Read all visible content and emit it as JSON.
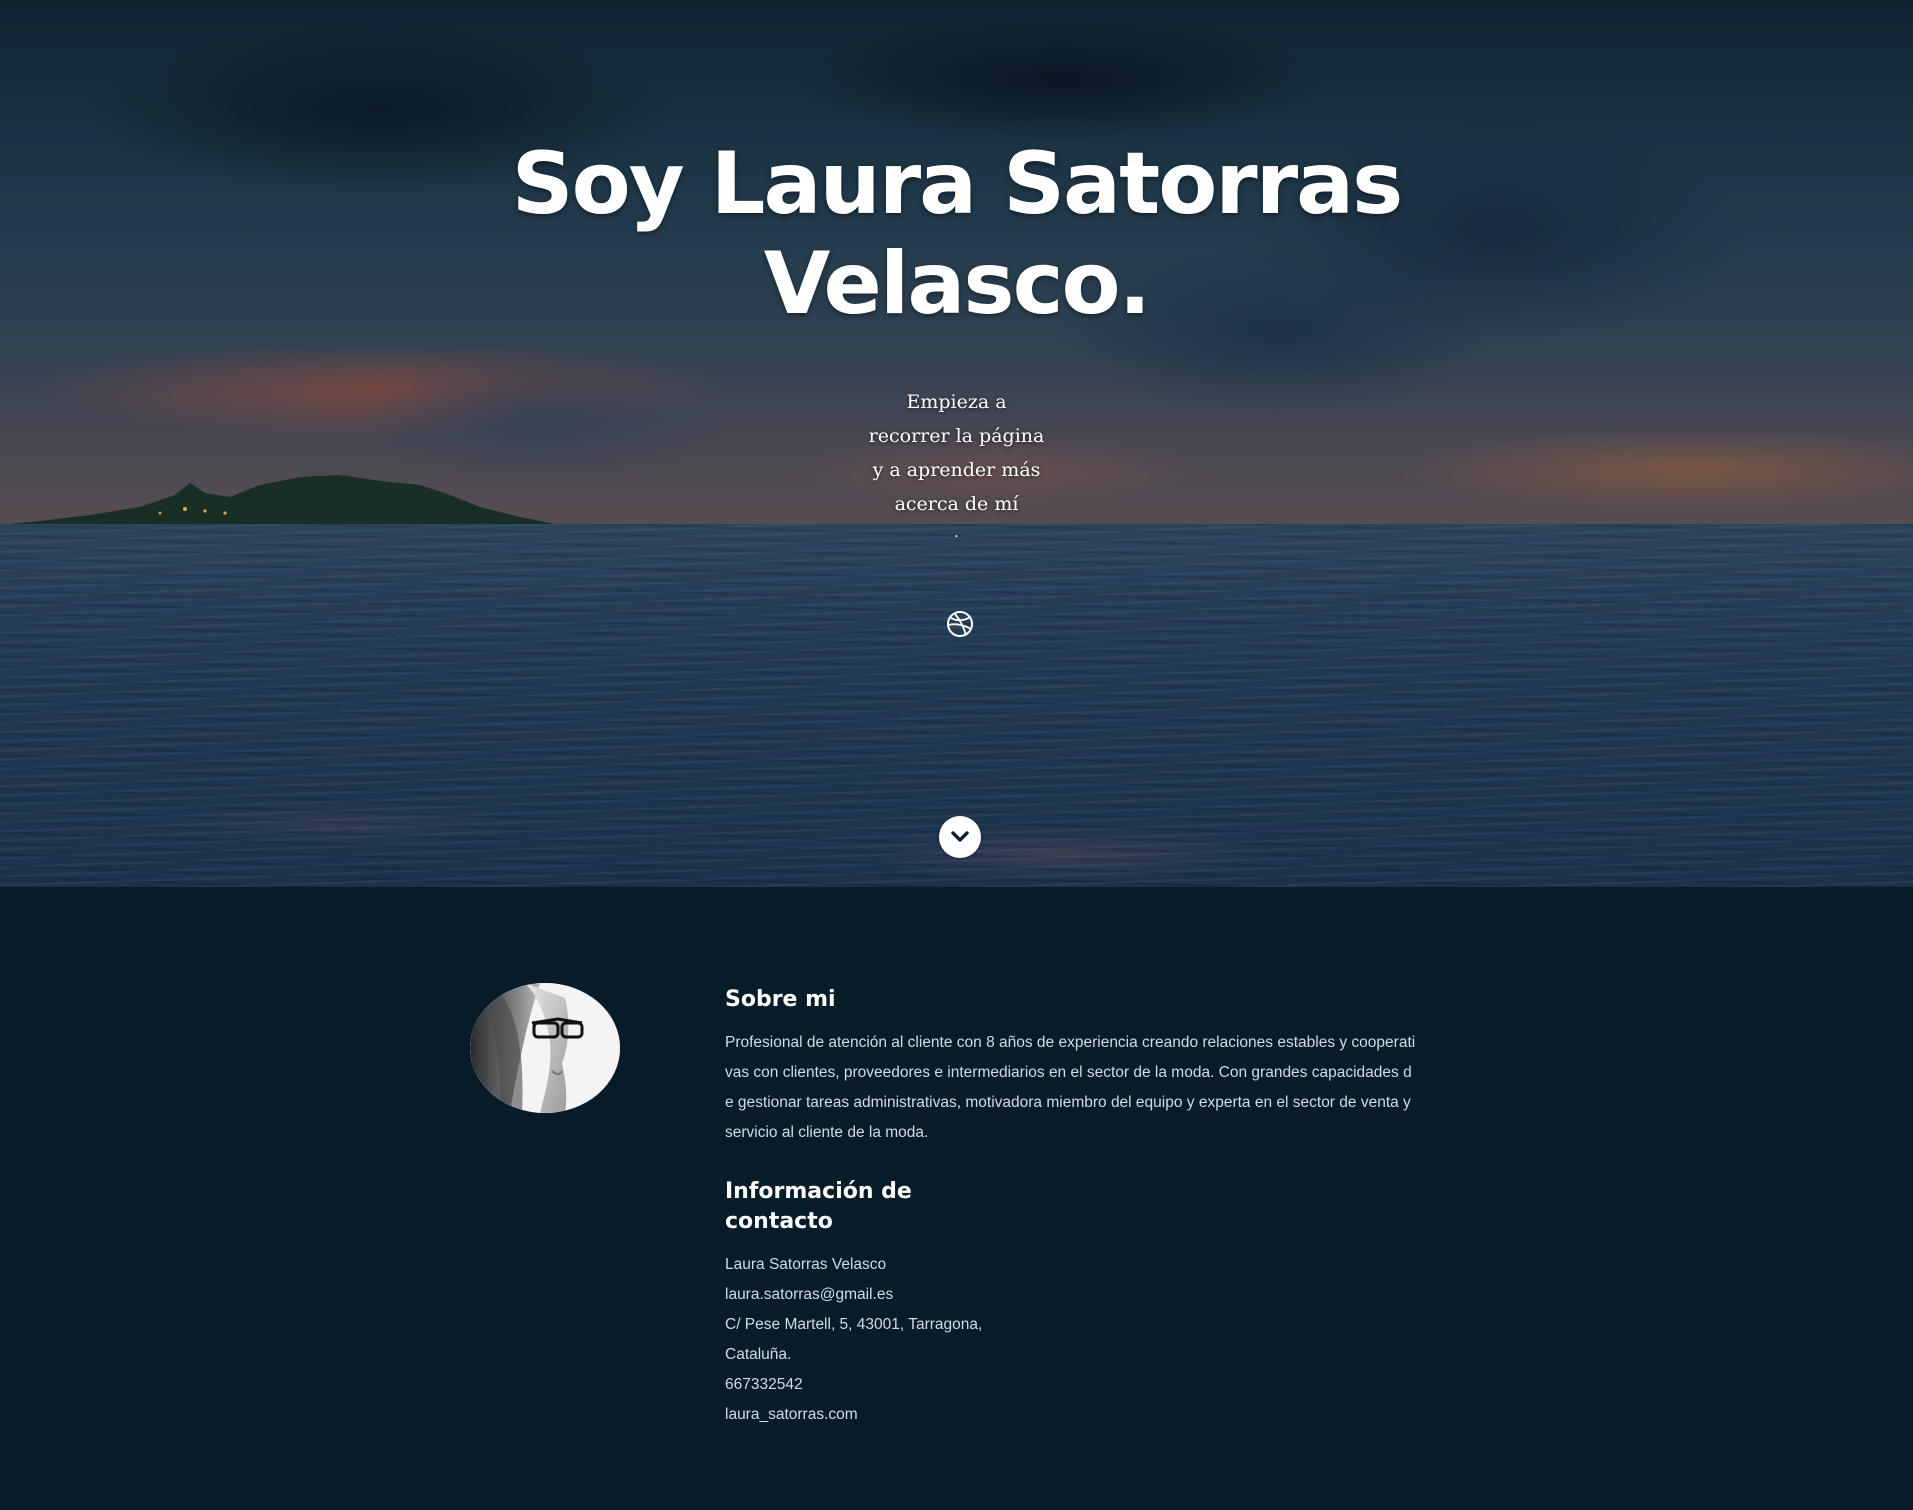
{
  "hero": {
    "title_line1": "Soy Laura Satorras",
    "title_line2": "Velasco.",
    "subtitle_lines": [
      "Empieza a",
      "recorrer la página",
      "y a aprender más",
      "acerca de mí"
    ],
    "subtitle_dot": ".",
    "social_icon": "dribbble-icon",
    "scroll_icon": "chevron-down-icon"
  },
  "about": {
    "title": "Sobre mi",
    "text": "Profesional de atención al cliente con 8 años de experiencia creando relaciones estables y cooperativas con clientes, proveedores e intermediarios en el sector de la moda. Con grandes capacidades de gestionar tareas administrativas, motivadora miembro del equipo y experta en el sector de venta y servicio al cliente de la moda."
  },
  "contact": {
    "title": "Información de contacto",
    "name": "Laura Satorras Velasco",
    "email": "laura.satorras@gmail.es",
    "address_line1": "C/ Pese Martell, 5, 43001, Tarragona,",
    "address_line2": "Cataluña.",
    "phone": "667332542",
    "website": "laura_satorras.com"
  },
  "colors": {
    "background": "#071b29",
    "text": "#d3dbe3",
    "heading": "#ffffff"
  }
}
